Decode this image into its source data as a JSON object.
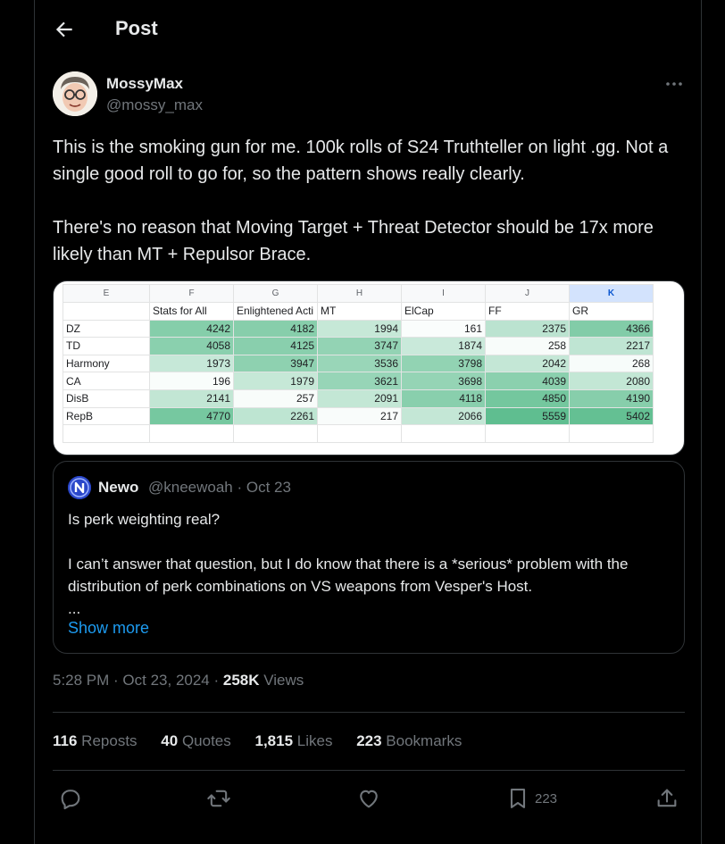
{
  "header": {
    "title": "Post"
  },
  "author": {
    "name": "MossyMax",
    "handle": "@mossy_max"
  },
  "post": {
    "paragraphs": [
      "This is the smoking gun for me. 100k rolls of S24 Truthteller on light .gg. Not a single good roll to go for, so the pattern shows really clearly.",
      "There's no reason that Moving Target + Threat Detector should be 17x more likely than MT + Repulsor Brace."
    ]
  },
  "spreadsheet": {
    "columns": [
      "E",
      "F",
      "G",
      "H",
      "I",
      "J",
      "K"
    ],
    "selected_column": "K",
    "headers": [
      "",
      "Stats for All",
      "Enlightened Acti",
      "MT",
      "ElCap",
      "FF",
      "GR"
    ],
    "rows": [
      {
        "label": "DZ",
        "values": [
          4242,
          4182,
          1994,
          161,
          2375,
          4366
        ]
      },
      {
        "label": "TD",
        "values": [
          4058,
          4125,
          3747,
          1874,
          258,
          2217
        ]
      },
      {
        "label": "Harmony",
        "values": [
          1973,
          3947,
          3536,
          3798,
          2042,
          268
        ]
      },
      {
        "label": "CA",
        "values": [
          196,
          1979,
          3621,
          3698,
          4039,
          2080
        ]
      },
      {
        "label": "DisB",
        "values": [
          2141,
          257,
          2091,
          4118,
          4850,
          4190
        ]
      },
      {
        "label": "RepB",
        "values": [
          4770,
          2261,
          217,
          2066,
          5559,
          5402
        ]
      }
    ]
  },
  "quote": {
    "name": "Newo",
    "meta": "@kneewoah · Oct 23",
    "text": "Is perk weighting real?\n\nI can’t answer that question, but I do know that there is a *serious* problem with the distribution of perk combinations on VS weapons from Vesper's Host.\n...",
    "show_more": "Show more"
  },
  "meta": {
    "time": "5:28 PM · Oct 23, 2024 · ",
    "views_count": "258K",
    "views_label": " Views"
  },
  "stats": {
    "reposts": "116",
    "reposts_label": "Reposts",
    "quotes": "40",
    "quotes_label": "Quotes",
    "likes": "1,815",
    "likes_label": "Likes",
    "bookmarks": "223",
    "bookmarks_label": "Bookmarks"
  },
  "actions": {
    "bookmark_count": "223"
  },
  "colors": {
    "background": "#000000",
    "text": "#e7e9ea",
    "muted": "#71767b",
    "link": "#1d9bf0",
    "border": "#2f3336",
    "heat": "#57bb8a"
  },
  "icons": [
    "back-arrow-icon",
    "more-icon",
    "reply-icon",
    "repost-icon",
    "like-icon",
    "bookmark-icon",
    "share-icon"
  ]
}
